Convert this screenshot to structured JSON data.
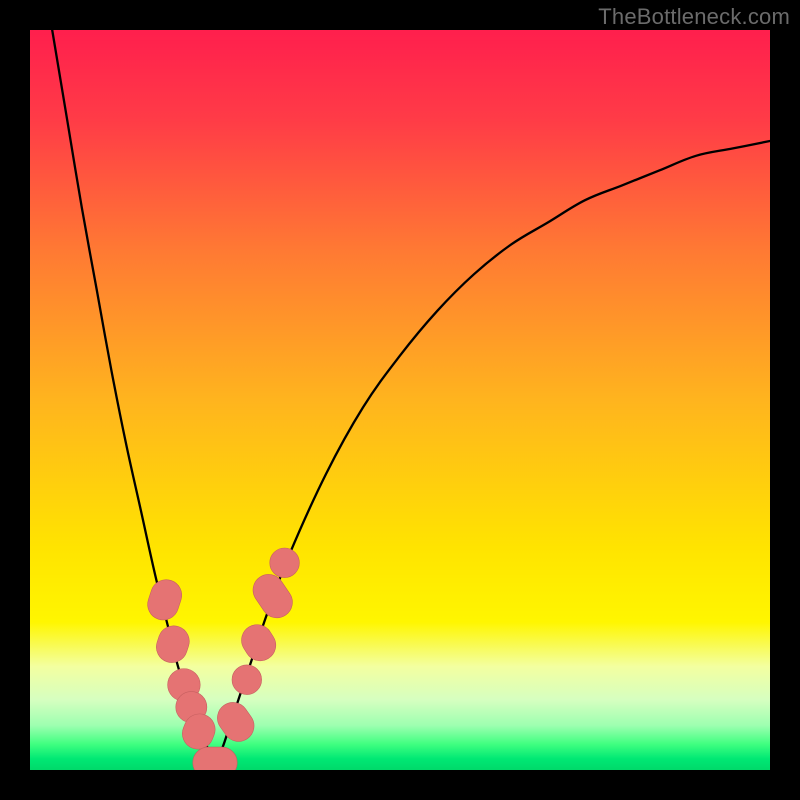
{
  "watermark": "TheBottleneck.com",
  "colors": {
    "frame_bg": "#000000",
    "watermark_text": "#6b6b6b",
    "curve_stroke": "#000000",
    "marker_fill": "#e57373",
    "marker_stroke": "#c76060",
    "gradient_stops": [
      {
        "offset": 0.0,
        "color": "#ff1f4d"
      },
      {
        "offset": 0.12,
        "color": "#ff3b47"
      },
      {
        "offset": 0.3,
        "color": "#ff7a33"
      },
      {
        "offset": 0.5,
        "color": "#ffb41e"
      },
      {
        "offset": 0.7,
        "color": "#ffe400"
      },
      {
        "offset": 0.8,
        "color": "#fff600"
      },
      {
        "offset": 0.86,
        "color": "#f3ffa0"
      },
      {
        "offset": 0.905,
        "color": "#d6ffc0"
      },
      {
        "offset": 0.94,
        "color": "#9dffb0"
      },
      {
        "offset": 0.965,
        "color": "#40ff80"
      },
      {
        "offset": 0.985,
        "color": "#00e874"
      },
      {
        "offset": 1.0,
        "color": "#00d96a"
      }
    ]
  },
  "chart_data": {
    "type": "line",
    "title": "",
    "xlabel": "",
    "ylabel": "",
    "xlim": [
      0,
      100
    ],
    "ylim": [
      0,
      100
    ],
    "series": [
      {
        "name": "bottleneck-curve-left",
        "x": [
          3,
          5,
          7,
          9,
          11,
          13,
          15,
          17,
          19,
          20,
          21,
          22,
          23,
          24,
          25
        ],
        "y": [
          100,
          88,
          76,
          65,
          54,
          44,
          35,
          26,
          18,
          14,
          11,
          8,
          5,
          3,
          1
        ]
      },
      {
        "name": "bottleneck-curve-right",
        "x": [
          25,
          26,
          27,
          28,
          29,
          30,
          32,
          35,
          40,
          45,
          50,
          55,
          60,
          65,
          70,
          75,
          80,
          85,
          90,
          95,
          100
        ],
        "y": [
          1,
          3,
          6,
          9,
          12,
          15,
          21,
          29,
          40,
          49,
          56,
          62,
          67,
          71,
          74,
          77,
          79,
          81,
          83,
          84,
          85
        ]
      }
    ],
    "markers": [
      {
        "name": "left-cluster-upper",
        "shape": "pill",
        "x": 18.2,
        "y": 23,
        "len": 5.5,
        "angle": -72
      },
      {
        "name": "left-cluster-upper-2",
        "shape": "pill",
        "x": 19.3,
        "y": 17,
        "len": 5.0,
        "angle": -72
      },
      {
        "name": "left-dot-1",
        "shape": "dot",
        "x": 20.8,
        "y": 11.5,
        "r": 2.2
      },
      {
        "name": "left-dot-2",
        "shape": "dot",
        "x": 21.8,
        "y": 8.5,
        "r": 2.1
      },
      {
        "name": "left-cluster-lower",
        "shape": "pill",
        "x": 22.8,
        "y": 5.2,
        "len": 4.8,
        "angle": -68
      },
      {
        "name": "valley-floor",
        "shape": "pill",
        "x": 25.0,
        "y": 1.0,
        "len": 6.0,
        "angle": 0
      },
      {
        "name": "right-cluster-lower",
        "shape": "pill",
        "x": 27.8,
        "y": 6.5,
        "len": 5.5,
        "angle": 55
      },
      {
        "name": "right-dot-1",
        "shape": "dot",
        "x": 29.3,
        "y": 12.2,
        "r": 2.0
      },
      {
        "name": "right-cluster-mid",
        "shape": "pill",
        "x": 30.9,
        "y": 17.2,
        "len": 5.0,
        "angle": 58
      },
      {
        "name": "right-cluster-upper",
        "shape": "pill",
        "x": 32.8,
        "y": 23.5,
        "len": 6.2,
        "angle": 56
      },
      {
        "name": "right-dot-2",
        "shape": "dot",
        "x": 34.4,
        "y": 28.0,
        "r": 2.0
      }
    ]
  }
}
